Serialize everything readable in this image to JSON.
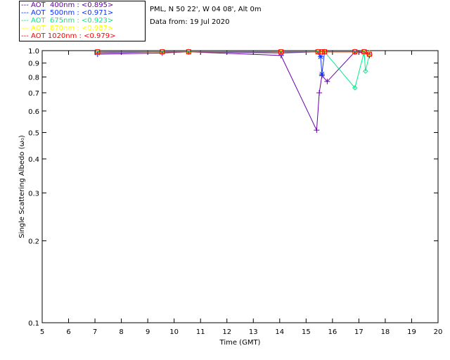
{
  "header": {
    "site": "PML, N 50 22', W 04 08', Alt 0m",
    "date": "Data from: 19 Jul 2020"
  },
  "chart_data": {
    "type": "scatter",
    "xlabel": "Time (GMT)",
    "ylabel": "Single Scattering Albedo (ω₀)",
    "xlim": [
      5,
      20
    ],
    "ylim": [
      0.1,
      1.0
    ],
    "yscale": "log",
    "xticks": [
      "5",
      "6",
      "7",
      "8",
      "9",
      "10",
      "11",
      "12",
      "13",
      "14",
      "15",
      "16",
      "17",
      "18",
      "19",
      "20"
    ],
    "yticks": [
      "0.1",
      "0.2",
      "0.3",
      "0.4",
      "0.5",
      "0.6",
      "0.7",
      "0.8",
      "0.9",
      "1.0"
    ],
    "grid": false,
    "legend_position": "top-left",
    "series": [
      {
        "name": "AOT  400nm : <0.895>",
        "color": "#6600aa",
        "marker": "plus",
        "points": [
          [
            7.1,
            0.97
          ],
          [
            9.55,
            0.98
          ],
          [
            10.55,
            0.99
          ],
          [
            14.05,
            0.96
          ],
          [
            15.4,
            0.51
          ],
          [
            15.5,
            0.7
          ],
          [
            15.6,
            0.81
          ],
          [
            15.8,
            0.77
          ],
          [
            16.85,
            0.99
          ],
          [
            17.2,
            0.98
          ],
          [
            17.4,
            0.96
          ]
        ]
      },
      {
        "name": "AOT  500nm : <0.971>",
        "color": "#1030ff",
        "marker": "asterisk",
        "points": [
          [
            7.1,
            0.98
          ],
          [
            9.55,
            0.99
          ],
          [
            10.55,
            0.99
          ],
          [
            14.05,
            0.98
          ],
          [
            15.45,
            0.99
          ],
          [
            15.55,
            0.95
          ],
          [
            15.6,
            0.82
          ],
          [
            15.7,
            0.99
          ],
          [
            16.85,
            0.99
          ],
          [
            17.2,
            0.99
          ],
          [
            17.4,
            0.97
          ]
        ]
      },
      {
        "name": "AOT  675nm : <0.923>",
        "color": "#00ee88",
        "marker": "diamond",
        "points": [
          [
            7.1,
            0.99
          ],
          [
            9.55,
            0.99
          ],
          [
            10.55,
            0.99
          ],
          [
            14.05,
            0.99
          ],
          [
            15.45,
            0.99
          ],
          [
            15.7,
            0.99
          ],
          [
            16.85,
            0.73
          ],
          [
            17.2,
            0.99
          ],
          [
            17.25,
            0.84
          ],
          [
            17.4,
            0.97
          ]
        ]
      },
      {
        "name": "AOT  870nm : <0.987>",
        "color": "#ffff00",
        "marker": "triangle",
        "points": [
          [
            7.1,
            0.99
          ],
          [
            9.55,
            0.99
          ],
          [
            10.55,
            0.99
          ],
          [
            14.05,
            0.99
          ],
          [
            15.45,
            0.99
          ],
          [
            15.6,
            0.99
          ],
          [
            15.7,
            0.99
          ],
          [
            16.85,
            0.99
          ],
          [
            17.2,
            0.99
          ],
          [
            17.4,
            0.98
          ]
        ]
      },
      {
        "name": "AOT 1020nm : <0.979>",
        "color": "#ff0000",
        "marker": "square",
        "points": [
          [
            7.1,
            0.99
          ],
          [
            9.55,
            0.99
          ],
          [
            10.55,
            0.99
          ],
          [
            14.05,
            0.99
          ],
          [
            15.45,
            0.99
          ],
          [
            15.6,
            0.99
          ],
          [
            15.7,
            0.99
          ],
          [
            16.85,
            0.99
          ],
          [
            17.2,
            0.99
          ],
          [
            17.4,
            0.97
          ]
        ]
      }
    ]
  }
}
